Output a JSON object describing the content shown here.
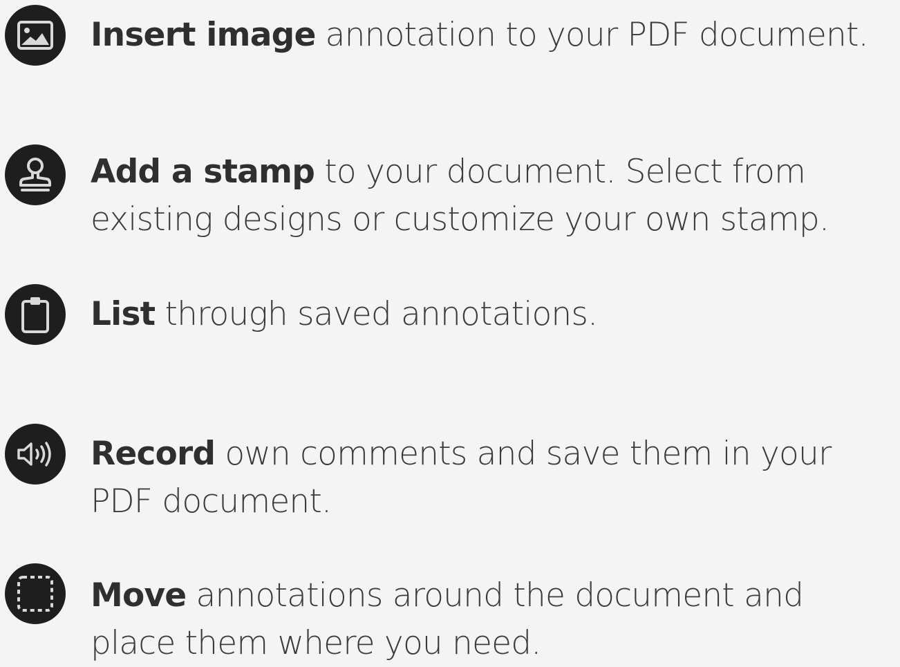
{
  "features": [
    {
      "icon": "image-icon",
      "bold": "Insert image",
      "rest": " annotation to your PDF document."
    },
    {
      "icon": "stamp-icon",
      "bold": "Add a stamp",
      "rest": " to your document. Select from existing designs or customize your own stamp."
    },
    {
      "icon": "clipboard-icon",
      "bold": "List",
      "rest": " through saved annotations."
    },
    {
      "icon": "speaker-icon",
      "bold": "Record",
      "rest": " own comments and save them in your PDF document."
    },
    {
      "icon": "selection-frame-icon",
      "bold": "Move",
      "rest": " annotations around the document and place them where you need."
    }
  ],
  "colors": {
    "background": "#f4f4f4",
    "icon_circle": "#1e1e1e",
    "icon_glyph": "#d9d9d9",
    "text": "#3b3b3b"
  }
}
